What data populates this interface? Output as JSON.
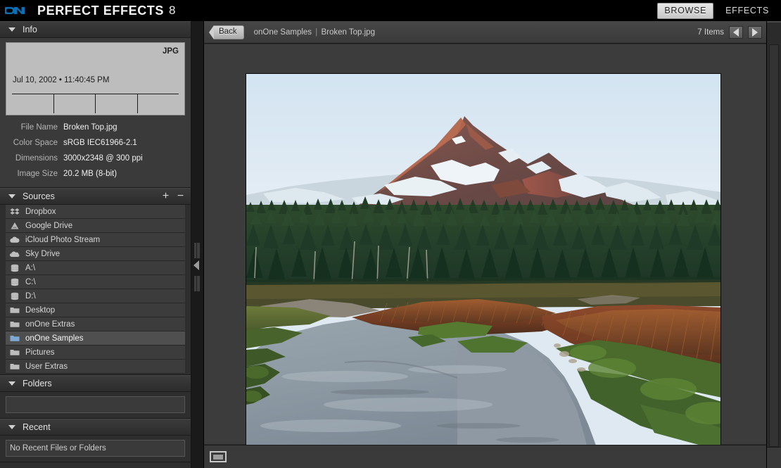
{
  "titlebar": {
    "logo_icon": "onone-logo-icon",
    "app_name": "PERFECT EFFECTS",
    "version": "8",
    "modes": [
      {
        "label": "BROWSE",
        "active": true
      },
      {
        "label": "EFFECTS",
        "active": false
      }
    ]
  },
  "sidebar": {
    "info": {
      "title": "Info",
      "disclosure_icon": "triangle-down-icon",
      "file_type_badge": "JPG",
      "capture_datetime": "Jul 10, 2002 • 11:40:45 PM",
      "metadata_cells": [
        "",
        "",
        "",
        ""
      ],
      "rows": [
        {
          "label": "File Name",
          "value": "Broken Top.jpg"
        },
        {
          "label": "Color Space",
          "value": "sRGB IEC61966-2.1"
        },
        {
          "label": "Dimensions",
          "value": "3000x2348 @ 300 ppi"
        },
        {
          "label": "Image Size",
          "value": "20.2 MB (8-bit)"
        }
      ]
    },
    "sources": {
      "title": "Sources",
      "disclosure_icon": "triangle-down-icon",
      "add_label": "+",
      "remove_label": "−",
      "items": [
        {
          "label": "Dropbox",
          "icon": "dropbox-icon",
          "selected": false
        },
        {
          "label": "Google Drive",
          "icon": "google-drive-icon",
          "selected": false
        },
        {
          "label": "iCloud Photo Stream",
          "icon": "icloud-icon",
          "selected": false
        },
        {
          "label": "Sky Drive",
          "icon": "skydrive-cloud-icon",
          "selected": false
        },
        {
          "label": "A:\\",
          "icon": "drive-icon",
          "selected": false
        },
        {
          "label": "C:\\",
          "icon": "drive-icon",
          "selected": false
        },
        {
          "label": "D:\\",
          "icon": "drive-icon",
          "selected": false
        },
        {
          "label": "Desktop",
          "icon": "folder-icon",
          "selected": false
        },
        {
          "label": "onOne Extras",
          "icon": "folder-icon",
          "selected": false
        },
        {
          "label": "onOne Samples",
          "icon": "folder-open-icon",
          "selected": true
        },
        {
          "label": "Pictures",
          "icon": "folder-icon",
          "selected": false
        },
        {
          "label": "User Extras",
          "icon": "folder-icon",
          "selected": false
        }
      ]
    },
    "folders": {
      "title": "Folders",
      "disclosure_icon": "triangle-down-icon",
      "empty_text": ""
    },
    "recent": {
      "title": "Recent",
      "disclosure_icon": "triangle-down-icon",
      "empty_text": "No Recent Files or Folders"
    }
  },
  "splitter": {
    "collapse_icon": "triangle-left-icon"
  },
  "browser": {
    "back_label": "Back",
    "back_icon": "chevron-left-icon",
    "breadcrumb_folder": "onOne Samples",
    "breadcrumb_separator": "|",
    "breadcrumb_file": "Broken Top.jpg",
    "item_count": "7 Items",
    "prev_icon": "triangle-left-icon",
    "next_icon": "triangle-right-icon"
  },
  "bottombar": {
    "view_toggle_icon": "single-image-view-icon"
  },
  "photo": {
    "alt": "Broken Top mountain with snow above a pine forest and a winding river"
  },
  "colors": {
    "accent_blue": "#0b6fb4",
    "panel_bg": "#2e2e2e",
    "panel_head": "#3b3b3b",
    "list_row": "#3c3c3c",
    "list_row_selected": "#4f4f4f",
    "canvas_bg": "#3c3c3c",
    "titlebar_bg": "#000000",
    "text_primary": "#f0f0f0",
    "text_secondary": "#b4b4b4"
  }
}
